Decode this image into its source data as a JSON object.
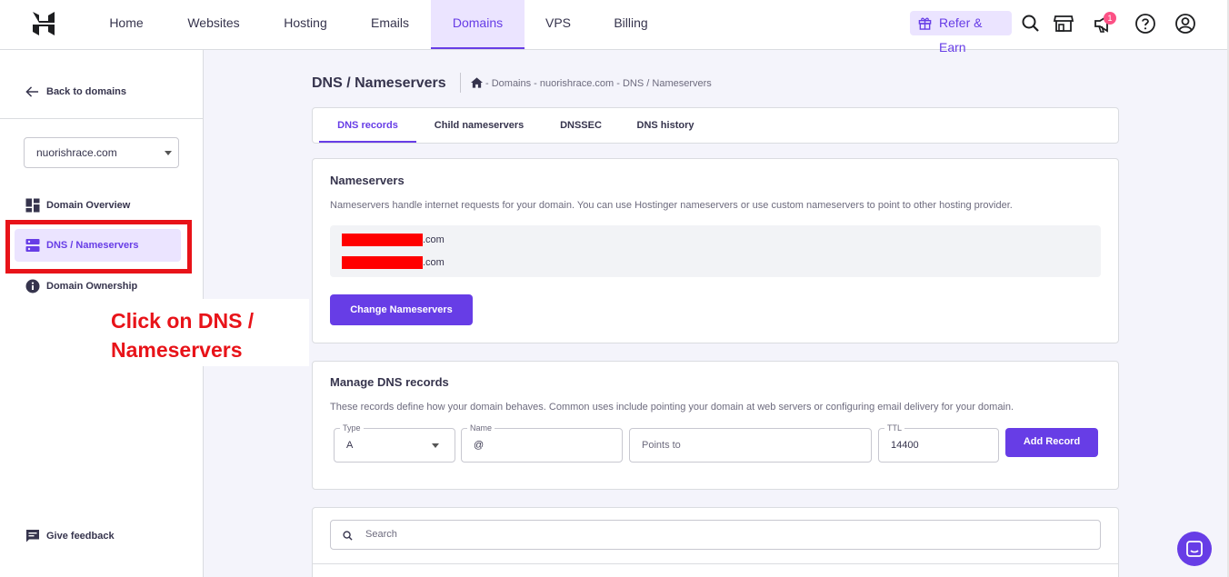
{
  "nav": {
    "items": [
      "Home",
      "Websites",
      "Hosting",
      "Emails",
      "Domains",
      "VPS",
      "Billing"
    ],
    "refer_label": "Refer & Earn",
    "notification_count": "1"
  },
  "sidebar": {
    "back_label": "Back to domains",
    "domain_selected": "nuorishrace.com",
    "items": [
      "Domain Overview",
      "DNS / Nameservers",
      "Domain Ownership"
    ],
    "feedback_label": "Give feedback"
  },
  "annotation": {
    "text": "Click on DNS / Nameservers"
  },
  "page": {
    "title": "DNS / Nameservers",
    "breadcrumb": "- Domains - nuorishrace.com - DNS / Nameservers"
  },
  "tabs": [
    "DNS records",
    "Child nameservers",
    "DNSSEC",
    "DNS history"
  ],
  "nameservers": {
    "title": "Nameservers",
    "description": "Nameservers handle internet requests for your domain. You can use Hostinger nameservers or use custom nameservers to point to other hosting provider.",
    "entries": [
      ".com",
      ".com"
    ],
    "button_label": "Change Nameservers"
  },
  "dns": {
    "title": "Manage DNS records",
    "description": "These records define how your domain behaves. Common uses include pointing your domain at web servers or configuring email delivery for your domain.",
    "type_label": "Type",
    "type_value": "A",
    "name_label": "Name",
    "name_value": "@",
    "points_placeholder": "Points to",
    "ttl_label": "TTL",
    "ttl_value": "14400",
    "add_label": "Add Record"
  },
  "records": {
    "search_placeholder": "Search"
  },
  "colors": {
    "accent": "#673de6",
    "accent_light": "#ebe4ff",
    "annotation_red": "#e81319",
    "redaction": "#ff0000"
  }
}
